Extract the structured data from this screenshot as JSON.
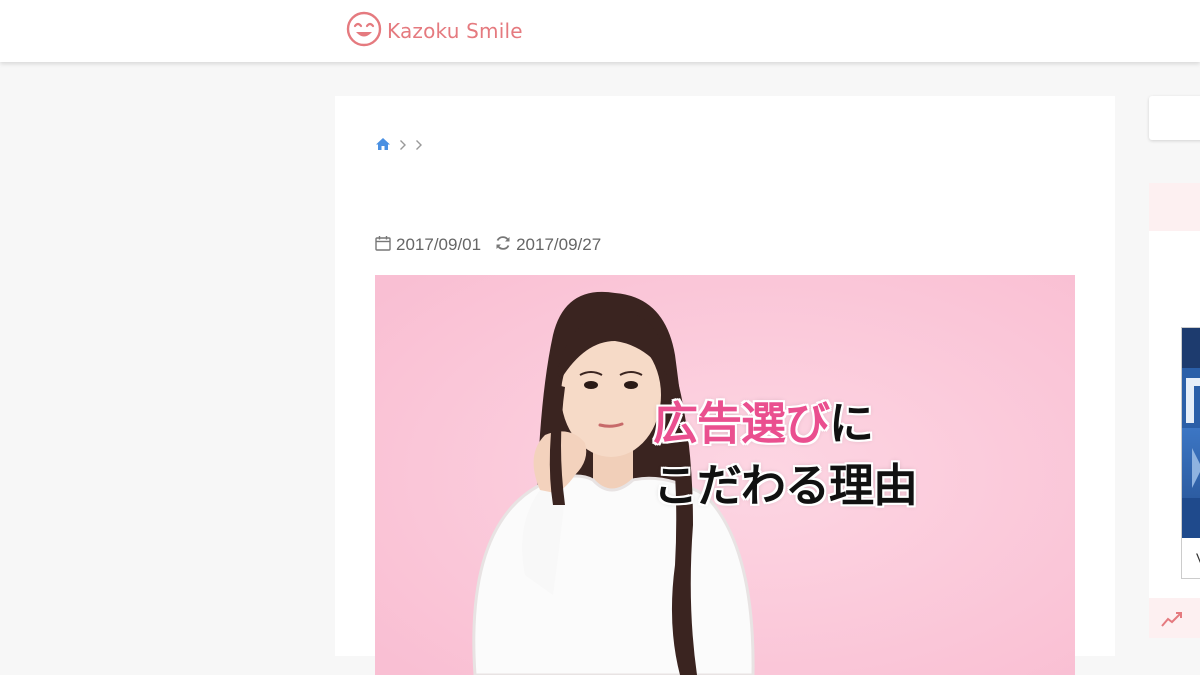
{
  "header": {
    "logo_text": "Kazoku Smile",
    "logo_color": "#e57a7f"
  },
  "breadcrumb": {
    "home_icon": "home-icon",
    "separator_icon": "chevron-right-icon",
    "home_color": "#4a90e2"
  },
  "article": {
    "published_date": "2017/09/01",
    "updated_date": "2017/09/27",
    "published_icon": "calendar-icon",
    "updated_icon": "refresh-icon"
  },
  "hero": {
    "line1_pink": "広告選び",
    "line1_dark": "に",
    "line2": "こだわる理由",
    "background_color": "#fcc8da",
    "accent_color": "#ea4f8f"
  },
  "sidebar": {
    "banner_caption": "V",
    "trend_icon": "trending-up-icon"
  }
}
